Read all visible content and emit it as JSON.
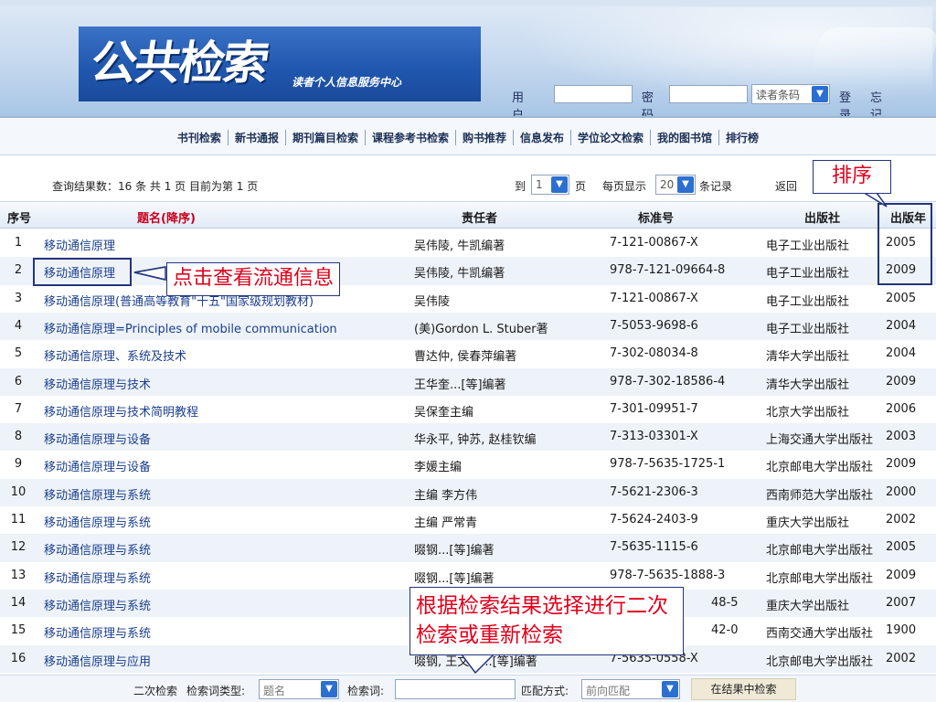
{
  "header": {
    "logo_title": "公共检索",
    "logo_subtitle": "读者个人信息服务中心",
    "username_label": "用户名",
    "password_label": "密码",
    "login_type": "读者条码",
    "login_link": "登录",
    "forgot_link": "忘记密码"
  },
  "nav": [
    "书刊检索",
    "新书通报",
    "期刊篇目检索",
    "课程参考书检索",
    "购书推荐",
    "信息发布",
    "学位论文检索",
    "我的图书馆",
    "排行榜"
  ],
  "result_info": {
    "summary": "查询结果数：16 条  共 1 页  目前为第 1 页",
    "goto_label": "到",
    "goto_page": "1",
    "page_unit": "页",
    "per_page_label": "每页显示",
    "per_page": "20",
    "record_unit": "条记录",
    "back": "返回"
  },
  "columns": {
    "no": "序号",
    "title": "题名",
    "sort_hint": "(降序)",
    "author": "责任者",
    "isbn": "标准号",
    "publisher": "出版社",
    "year": "出版年"
  },
  "rows": [
    {
      "no": "1",
      "title": "移动通信原理",
      "author": "吴伟陵, 牛凯编著",
      "isbn": "7-121-00867-X",
      "publisher": "电子工业出版社",
      "year": "2005"
    },
    {
      "no": "2",
      "title": "移动通信原理",
      "author": "吴伟陵, 牛凯编著",
      "isbn": "978-7-121-09664-8",
      "publisher": "电子工业出版社",
      "year": "2009"
    },
    {
      "no": "3",
      "title": "移动通信原理(普通高等教育\"十五\"国家级规划教材)",
      "author": "吴伟陵",
      "isbn": "7-121-00867-X",
      "publisher": "电子工业出版社",
      "year": "2005"
    },
    {
      "no": "4",
      "title": "移动通信原理=Principles of mobile communication",
      "author": "(美)Gordon L. Stuber著",
      "isbn": "7-5053-9698-6",
      "publisher": "电子工业出版社",
      "year": "2004"
    },
    {
      "no": "5",
      "title": "移动通信原理、系统及技术",
      "author": "曹达仲, 侯春萍编著",
      "isbn": "7-302-08034-8",
      "publisher": "清华大学出版社",
      "year": "2004"
    },
    {
      "no": "6",
      "title": "移动通信原理与技术",
      "author": "王华奎...[等]编著",
      "isbn": "978-7-302-18586-4",
      "publisher": "清华大学出版社",
      "year": "2009"
    },
    {
      "no": "7",
      "title": "移动通信原理与技术简明教程",
      "author": "吴保奎主编",
      "isbn": "7-301-09951-7",
      "publisher": "北京大学出版社",
      "year": "2006"
    },
    {
      "no": "8",
      "title": "移动通信原理与设备",
      "author": "华永平, 钟苏, 赵桂钦编",
      "isbn": "7-313-03301-X",
      "publisher": "上海交通大学出版社",
      "year": "2003"
    },
    {
      "no": "9",
      "title": "移动通信原理与设备",
      "author": "李媛主编",
      "isbn": "978-7-5635-1725-1",
      "publisher": "北京邮电大学出版社",
      "year": "2009"
    },
    {
      "no": "10",
      "title": "移动通信原理与系统",
      "author": "主编 李方伟",
      "isbn": "7-5621-2306-3",
      "publisher": "西南师范大学出版社",
      "year": "2000"
    },
    {
      "no": "11",
      "title": "移动通信原理与系统",
      "author": "主编 严常青",
      "isbn": "7-5624-2403-9",
      "publisher": "重庆大学出版社",
      "year": "2002"
    },
    {
      "no": "12",
      "title": "移动通信原理与系统",
      "author": "啜钢...[等]编著",
      "isbn": "7-5635-1115-6",
      "publisher": "北京邮电大学出版社",
      "year": "2005"
    },
    {
      "no": "13",
      "title": "移动通信原理与系统",
      "author": "啜钢...[等]编著",
      "isbn": "978-7-5635-1888-3",
      "publisher": "北京邮电大学出版社",
      "year": "2009"
    },
    {
      "no": "14",
      "title": "移动通信原理与系统",
      "author": "",
      "isbn": "48-5",
      "publisher": "重庆大学出版社",
      "year": "2007"
    },
    {
      "no": "15",
      "title": "移动通信原理与系统",
      "author": "",
      "isbn": "42-0",
      "publisher": "西南交通大学出版社",
      "year": "1900"
    },
    {
      "no": "16",
      "title": "移动通信原理与应用",
      "author": "啜钢, 王文博...[等]编著",
      "isbn": "7-5635-0558-X",
      "publisher": "北京邮电大学出版社",
      "year": "2002"
    }
  ],
  "bottom": {
    "secondary_label": "二次检索",
    "type_label": "检索词类型:",
    "type_value": "题名",
    "keyword_label": "检索词:",
    "match_label": "匹配方式:",
    "match_value": "前向匹配",
    "search_button": "在结果中检索"
  },
  "annotations": {
    "sort": "排序",
    "click": "点击查看流通信息",
    "refine": "根据检索结果选择进行二次检索或重新检索"
  }
}
